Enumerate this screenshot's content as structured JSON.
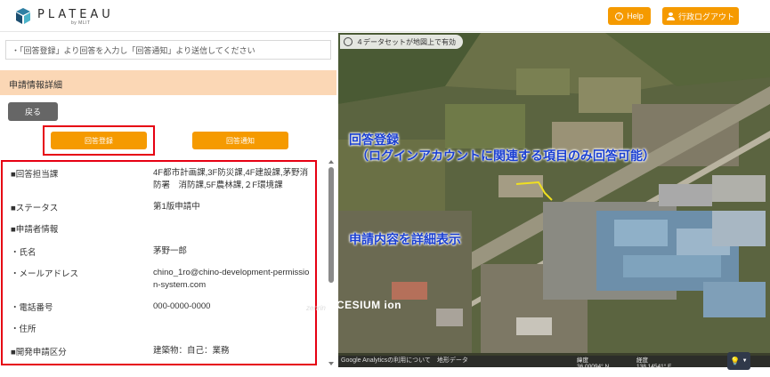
{
  "header": {
    "logo_text": "PLATEAU",
    "logo_sub": "by MLIT",
    "help_label": "Help",
    "logout_label": "行政ログアウト",
    "accent": "#f59a00"
  },
  "left": {
    "notice": "・「回答登録」より回答を入力し「回答通知」より送信してください",
    "section_title": "申請情報詳細",
    "back_label": "戻る",
    "answer_register_label": "回答登録",
    "answer_notify_label": "回答通知",
    "rows": [
      {
        "label": "■回答担当課",
        "value": "4F都市計画課,3F防災課,4F建設課,茅野消防署　消防課,5F農林課,２F環境課"
      },
      {
        "label": "■ステータス",
        "value": "第1版申請中"
      },
      {
        "label": "■申請者情報",
        "value": ""
      },
      {
        "label": "・氏名",
        "value": "茅野一郎"
      },
      {
        "label": "・メールアドレス",
        "value": "chino_1ro@chino-development-permission-system.com"
      },
      {
        "label": "・電話番号",
        "value": "000-0000-0000"
      },
      {
        "label": "・住所",
        "value": ""
      },
      {
        "label": "■開発申請区分",
        "value": "建築物：自己：業務"
      }
    ]
  },
  "map": {
    "status": "４データセットが地図上で有効",
    "annotation_1": "回答登録",
    "annotation_2": "（ログインアカウントに関連する項目のみ回答可能）",
    "annotation_3": "申請内容を詳細表示",
    "cesium_label": "CESIUM ion",
    "zenrin_label": "zenrin",
    "attribution": "Google Analyticsの利用について　地形データ",
    "lat_label": "緯度",
    "lat_value": "36.00094° N",
    "lon_label": "経度",
    "lon_value": "138.14541° E",
    "light_icon": "lightbulb-icon"
  },
  "colors": {
    "highlight_red": "#e60012",
    "annotation_blue": "#1a3fd1",
    "section_bg": "#fbd7b5"
  }
}
